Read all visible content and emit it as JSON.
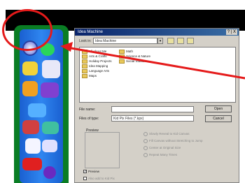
{
  "dialog": {
    "title": "Idea Machine",
    "title_buttons": "? | X",
    "look_in_label": "Look in:",
    "look_in_value": "Idea Machine",
    "folders": [
      "All About Me",
      "Arts & Crafts",
      "Holiday Projects",
      "Idea Mapping",
      "Language Arts",
      "Maps",
      "Math",
      "Science & Nature",
      "Social Studies"
    ],
    "file_name_label": "File name:",
    "file_name_value": "",
    "files_of_type_label": "Files of type:",
    "files_of_type_value": "Kid Pix Files (*.kpx)",
    "open_label": "Open",
    "cancel_label": "Cancel",
    "preview_label": "Preview",
    "options": [
      "Slowly Reveal to Kid Canvas",
      "Fill Canvas without Stretching to Jump",
      "Center at Original Size",
      "Repeat Many Times"
    ],
    "preview_checkbox_label": "Preview",
    "preview_checked": true,
    "second_checkbox_label": "Also add to Kid Pix"
  },
  "annotation": {
    "color": "#e51a1a"
  }
}
